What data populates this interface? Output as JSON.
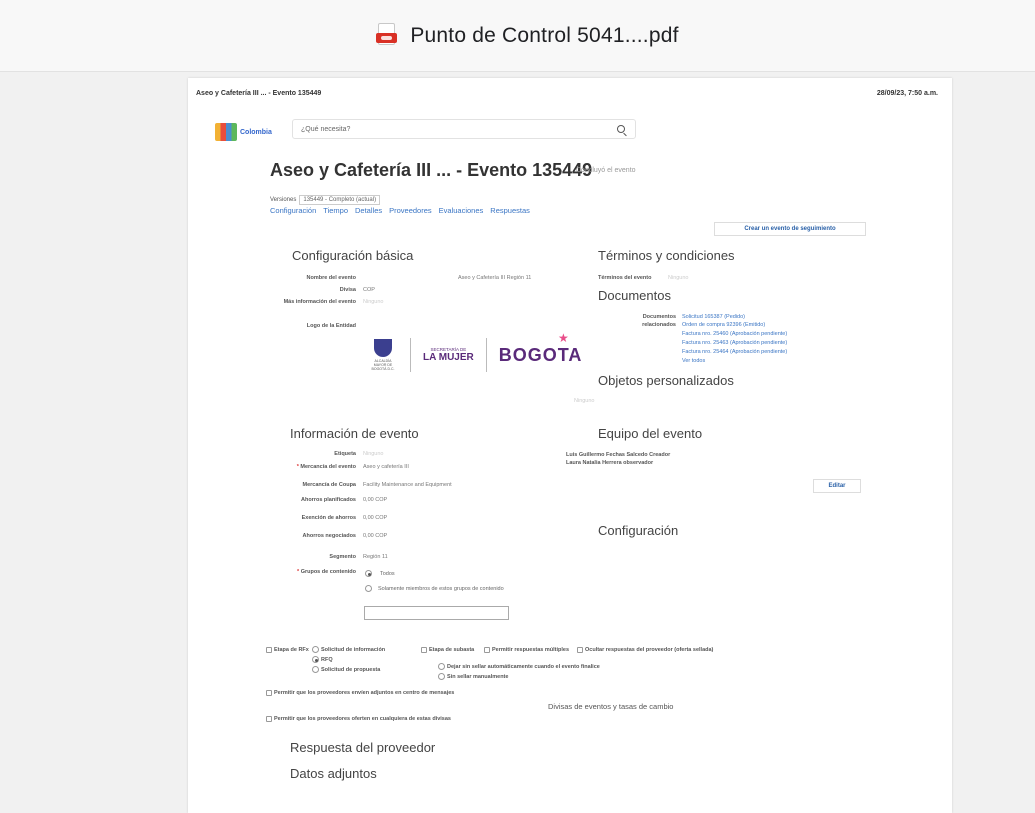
{
  "viewer": {
    "filename": "Punto de Control 5041....pdf"
  },
  "page": {
    "header_left": "Aseo y Cafetería III ... - Evento 135449",
    "header_right": "28/09/23, 7:50 a.m.",
    "logo_text": "Colombia",
    "search_placeholder": "¿Qué necesita?",
    "event_title": "Aseo y Cafetería III ... - Evento 135449",
    "event_status": "Concluyó el evento",
    "versions_label": "Versiones",
    "versions_value": "135449 - Completo (actual)",
    "tabs": [
      "Configuración",
      "Tiempo",
      "Detalles",
      "Proveedores",
      "Evaluaciones",
      "Respuestas"
    ],
    "followup_button": "Crear un evento de seguimiento",
    "basic": {
      "heading": "Configuración básica",
      "event_name_label": "Nombre del evento",
      "event_name_value": "Aseo y Cafetería III Región 11",
      "currency_label": "Divisa",
      "currency_value": "COP",
      "more_info_label": "Más información del evento",
      "more_info_value": "Ninguno",
      "logo_label": "Logo de la Entidad"
    },
    "partner_logo": {
      "crest_text": "ALCALDÍA MAYOR DE BOGOTÁ D.C.",
      "secretaria": "SECRETARÍA DE",
      "mujer": "LA MUJER",
      "bogota": "BOGOTA"
    },
    "terms": {
      "heading": "Términos y condiciones",
      "label": "Términos del evento",
      "value": "Ninguno"
    },
    "documents": {
      "heading": "Documentos",
      "docs_label": "Documentos",
      "docs_value": "Solicitud 165387 (Pedido)",
      "related_label": "relacionados",
      "items": [
        "Orden de compra 92396 (Emitido)",
        "Factura nro. 25460 (Aprobación pendiente)",
        "Factura nro. 25463 (Aprobación pendiente)",
        "Factura nro. 25464 (Aprobación pendiente)",
        "Ver todos"
      ]
    },
    "custom": {
      "heading": "Objetos personalizados",
      "value": "Ninguno"
    },
    "info": {
      "heading": "Información de evento",
      "rows": [
        {
          "label": "Etiqueta",
          "value": "Ninguno"
        },
        {
          "label": "Mercancía del evento",
          "value": "Aseo y cafetería III"
        },
        {
          "label": "Mercancía de Coupa",
          "value": "Facility Maintenance and Equipment"
        },
        {
          "label": "Ahorros planificados",
          "value": "0,00 COP"
        },
        {
          "label": "Exención de ahorros",
          "value": "0,00 COP"
        },
        {
          "label": "Ahorros negociados",
          "value": "0,00 COP"
        },
        {
          "label": "Segmento",
          "value": "Región 11"
        }
      ],
      "groups_label": "Grupos de contenido",
      "groups_all": "Todos",
      "groups_only": "Solamente miembros de estos grupos de contenido"
    },
    "team": {
      "heading": "Equipo del evento",
      "members": [
        "Luis Guillermo Fechas Salcedo Creador",
        "Laura Natalia Herrera observador"
      ],
      "edit_button": "Editar"
    },
    "config": {
      "heading": "Configuración"
    },
    "options": {
      "rfx_stage": "Etapa de RFx",
      "info_request": "Solicitud de información",
      "rfq": "RFQ",
      "proposal_request": "Solicitud de propuesta",
      "auction_stage": "Etapa de subasta",
      "multiple_responses": "Permitir respuestas múltiples",
      "hide_responses": "Ocultar respuestas del proveedor (oferta sellada)",
      "unseal_auto": "Dejar sin sellar automáticamente cuando el evento finalice",
      "unseal_manual": "Sin sellar manualmente",
      "attachments": "Permitir que los proveedores envíen adjuntos en centro de mensajes",
      "currencies_allow": "Permitir que los proveedores oferten en cualquiera de estas divisas",
      "currencies_heading": "Divisas de eventos y tasas de cambio"
    },
    "supplier_response": "Respuesta del proveedor",
    "attachments_heading": "Datos adjuntos"
  }
}
